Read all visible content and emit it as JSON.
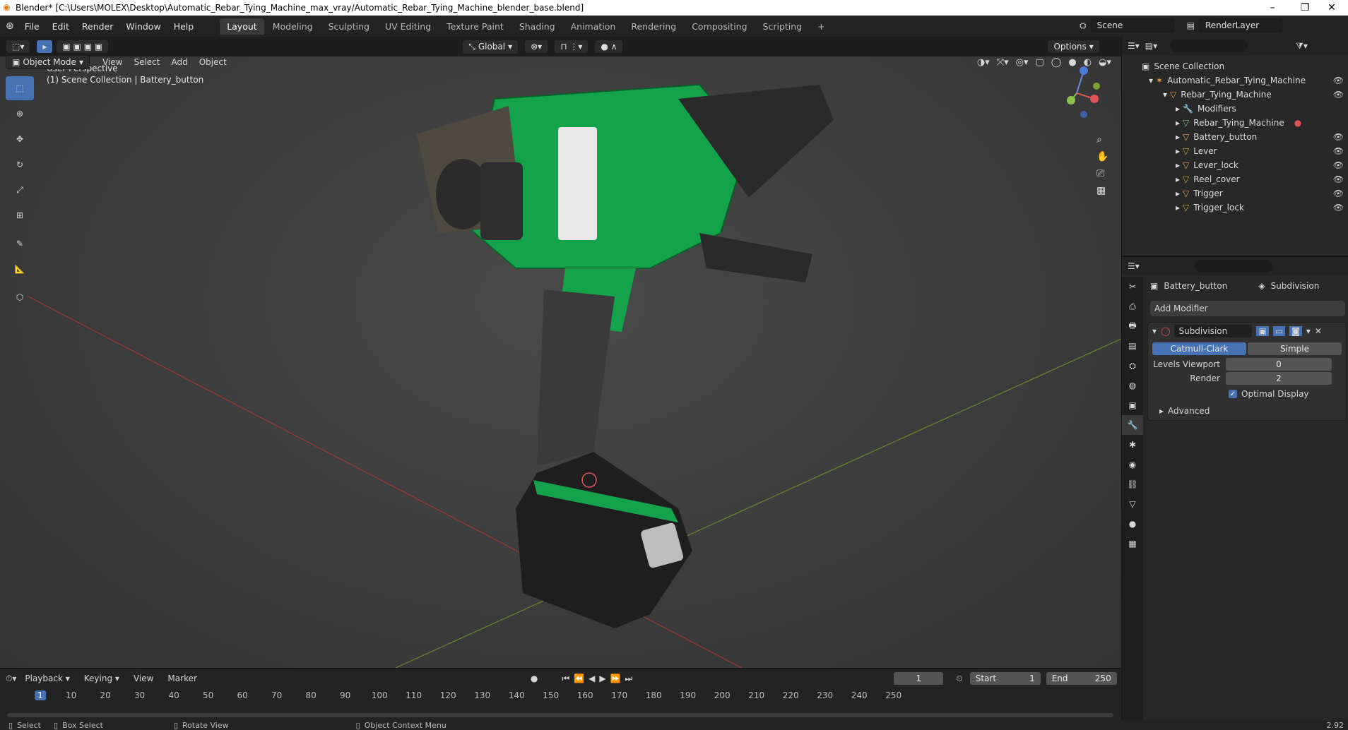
{
  "window": {
    "title": "Blender* [C:\\Users\\MOLEX\\Desktop\\Automatic_Rebar_Tying_Machine_max_vray/Automatic_Rebar_Tying_Machine_blender_base.blend]"
  },
  "menu": [
    "File",
    "Edit",
    "Render",
    "Window",
    "Help"
  ],
  "workspaces": [
    "Layout",
    "Modeling",
    "Sculpting",
    "UV Editing",
    "Texture Paint",
    "Shading",
    "Animation",
    "Rendering",
    "Compositing",
    "Scripting"
  ],
  "active_workspace": "Layout",
  "scene": {
    "label": "Scene",
    "render_layer": "RenderLayer"
  },
  "viewport": {
    "mode": "Object Mode",
    "menus": [
      "View",
      "Select",
      "Add",
      "Object"
    ],
    "transform": "Global",
    "options": "Options",
    "overlay_title": "User Perspective",
    "overlay_sub": "(1) Scene Collection | Battery_button"
  },
  "outliner": {
    "root": "Scene Collection",
    "items": [
      {
        "label": "Automatic_Rebar_Tying_Machine",
        "indent": 1
      },
      {
        "label": "Rebar_Tying_Machine",
        "indent": 2
      },
      {
        "label": "Modifiers",
        "indent": 3
      },
      {
        "label": "Rebar_Tying_Machine",
        "indent": 3
      },
      {
        "label": "Battery_button",
        "indent": 3
      },
      {
        "label": "Lever",
        "indent": 3
      },
      {
        "label": "Lever_lock",
        "indent": 3
      },
      {
        "label": "Reel_cover",
        "indent": 3
      },
      {
        "label": "Trigger",
        "indent": 3
      },
      {
        "label": "Trigger_lock",
        "indent": 3
      }
    ]
  },
  "properties": {
    "object": "Battery_button",
    "modifier_tab": "Subdivision",
    "add_modifier": "Add Modifier",
    "modifier_name": "Subdivision",
    "catmull": "Catmull-Clark",
    "simple": "Simple",
    "levels_label": "Levels Viewport",
    "levels_value": "0",
    "render_label": "Render",
    "render_value": "2",
    "optimal": "Optimal Display",
    "advanced": "Advanced"
  },
  "timeline": {
    "menus": [
      "Playback",
      "Keying",
      "View",
      "Marker"
    ],
    "current_frame": "1",
    "start_label": "Start",
    "start": "1",
    "end_label": "End",
    "end": "250",
    "ticks": [
      "1",
      "10",
      "20",
      "30",
      "40",
      "50",
      "60",
      "70",
      "80",
      "90",
      "100",
      "110",
      "120",
      "130",
      "140",
      "150",
      "160",
      "170",
      "180",
      "190",
      "200",
      "210",
      "220",
      "230",
      "240",
      "250"
    ]
  },
  "status": {
    "select": "Select",
    "box_select": "Box Select",
    "rotate": "Rotate View",
    "context": "Object Context Menu",
    "version": "2.92"
  }
}
